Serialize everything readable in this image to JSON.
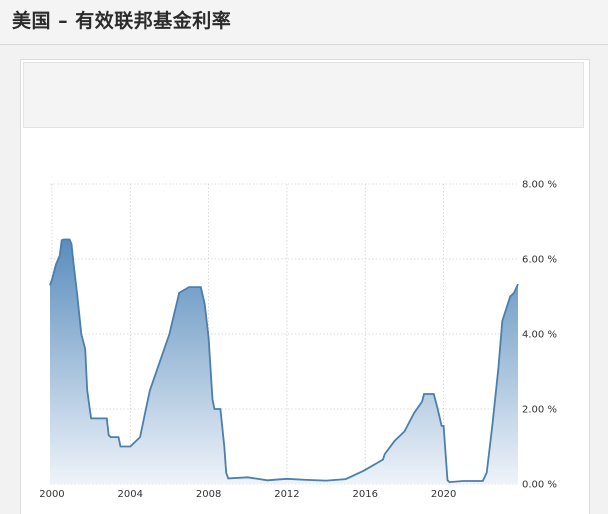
{
  "page": {
    "title": "美国 – 有效联邦基金利率"
  },
  "chart_data": {
    "type": "area",
    "title": "美国 – 有效联邦基金利率",
    "xlabel": "",
    "ylabel": "",
    "x_ticks": [
      "2000",
      "2004",
      "2008",
      "2012",
      "2016",
      "2020"
    ],
    "y_ticks": [
      "0.00 %",
      "2.00 %",
      "4.00 %",
      "6.00 %",
      "8.00 %"
    ],
    "xlim": [
      1999.9,
      2023.8
    ],
    "ylim": [
      0,
      8
    ],
    "grid": true,
    "y_axis_position": "right",
    "colors": {
      "line": "#4a7fae",
      "fill_top": "#5a8dbd",
      "fill_bottom": "#eef3f9"
    },
    "series": [
      {
        "x": [
          1999.9,
          2000.0,
          2000.2,
          2000.4,
          2000.5,
          2000.6,
          2000.9,
          2001.0,
          2001.1,
          2001.3,
          2001.5,
          2001.7,
          2001.8,
          2002.0,
          2002.4,
          2002.8,
          2002.9,
          2003.0,
          2003.4,
          2003.5,
          2003.9,
          2004.0,
          2004.5,
          2004.8,
          2005.0,
          2005.5,
          2006.0,
          2006.5,
          2007.0,
          2007.6,
          2007.8,
          2008.0,
          2008.2,
          2008.3,
          2008.6,
          2008.8,
          2008.9,
          2009.0,
          2010.0,
          2011.0,
          2012.0,
          2013.0,
          2014.0,
          2015.0,
          2015.9,
          2016.0,
          2016.9,
          2017.0,
          2017.5,
          2018.0,
          2018.5,
          2018.9,
          2019.0,
          2019.5,
          2019.7,
          2019.9,
          2020.0,
          2020.2,
          2020.3,
          2021.0,
          2022.0,
          2022.2,
          2022.5,
          2022.8,
          2023.0,
          2023.4,
          2023.6,
          2023.8
        ],
        "y": [
          5.3,
          5.45,
          5.85,
          6.1,
          6.5,
          6.52,
          6.52,
          6.4,
          5.9,
          5.0,
          4.0,
          3.6,
          2.5,
          1.75,
          1.75,
          1.75,
          1.3,
          1.25,
          1.25,
          1.0,
          1.0,
          1.0,
          1.25,
          2.0,
          2.5,
          3.25,
          4.0,
          5.1,
          5.25,
          5.25,
          4.8,
          3.9,
          2.25,
          2.0,
          2.0,
          1.0,
          0.3,
          0.15,
          0.18,
          0.1,
          0.14,
          0.11,
          0.09,
          0.13,
          0.35,
          0.38,
          0.65,
          0.8,
          1.15,
          1.4,
          1.9,
          2.2,
          2.4,
          2.4,
          2.0,
          1.55,
          1.55,
          0.1,
          0.05,
          0.08,
          0.08,
          0.3,
          1.6,
          3.1,
          4.35,
          5.0,
          5.1,
          5.33
        ]
      }
    ]
  }
}
